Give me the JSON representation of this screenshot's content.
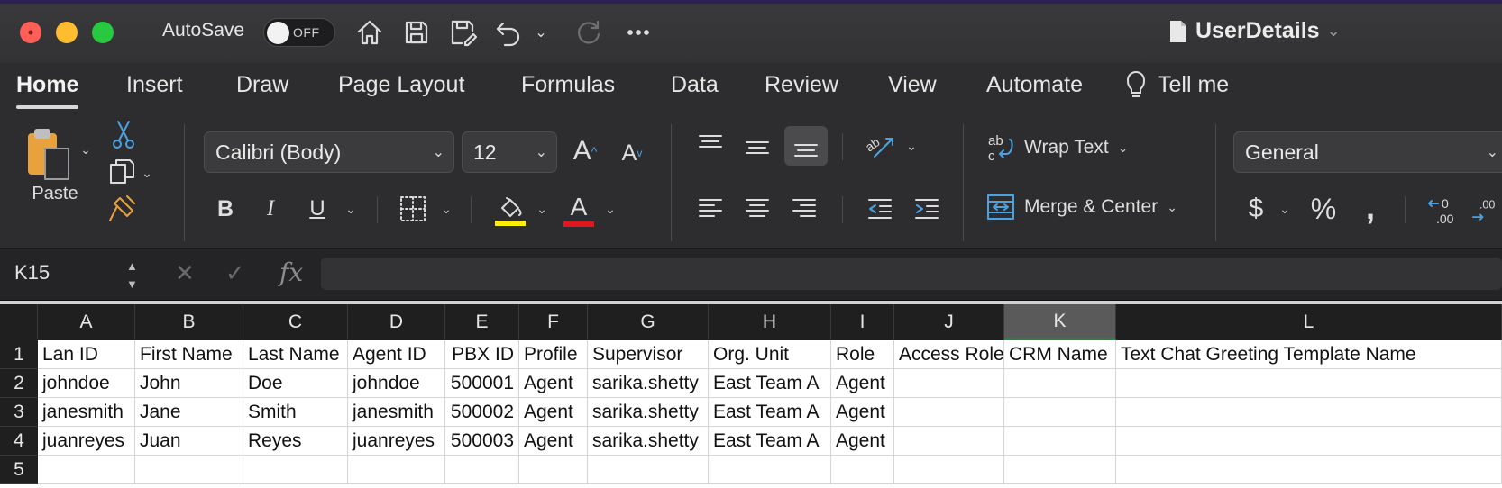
{
  "titlebar": {
    "autosave_label": "AutoSave",
    "autosave_state": "OFF",
    "document_title": "UserDetails",
    "icons": [
      "home-icon",
      "save-icon",
      "save-as-icon",
      "undo-icon",
      "redo-icon",
      "more-icon"
    ]
  },
  "ribbon_tabs": [
    "Home",
    "Insert",
    "Draw",
    "Page Layout",
    "Formulas",
    "Data",
    "Review",
    "View",
    "Automate"
  ],
  "active_tab": "Home",
  "tell_me": "Tell me",
  "ribbon": {
    "paste_label": "Paste",
    "font_name": "Calibri (Body)",
    "font_size": "12",
    "wrap_text": "Wrap Text",
    "merge_center": "Merge & Center",
    "number_format": "General",
    "fill_color": "#ffee00",
    "font_color": "#e0181b"
  },
  "formula_bar": {
    "name_box": "K15",
    "formula": ""
  },
  "grid": {
    "columns": [
      "A",
      "B",
      "C",
      "D",
      "E",
      "F",
      "G",
      "H",
      "I",
      "J",
      "K",
      "L"
    ],
    "selected_column": "K",
    "row_numbers": [
      "1",
      "2",
      "3",
      "4",
      "5"
    ],
    "rows": [
      [
        "Lan ID",
        "First Name",
        "Last Name",
        "Agent ID",
        "PBX ID",
        "Profile",
        "Supervisor",
        "Org. Unit",
        "Role",
        "Access Role",
        "CRM Name",
        "Text Chat Greeting Template Name"
      ],
      [
        "johndoe",
        "John",
        "Doe",
        "johndoe",
        "500001",
        "Agent",
        "sarika.shetty",
        "East Team A",
        "Agent",
        "",
        "",
        ""
      ],
      [
        "janesmith",
        "Jane",
        "Smith",
        "janesmith",
        "500002",
        "Agent",
        "sarika.shetty",
        "East Team A",
        "Agent",
        "",
        "",
        ""
      ],
      [
        "juanreyes",
        "Juan",
        "Reyes",
        "juanreyes",
        "500003",
        "Agent",
        "sarika.shetty",
        "East Team A",
        "Agent",
        "",
        "",
        ""
      ],
      [
        "",
        "",
        "",
        "",
        "",
        "",
        "",
        "",
        "",
        "",
        "",
        ""
      ]
    ],
    "numeric_columns": [
      4
    ]
  }
}
